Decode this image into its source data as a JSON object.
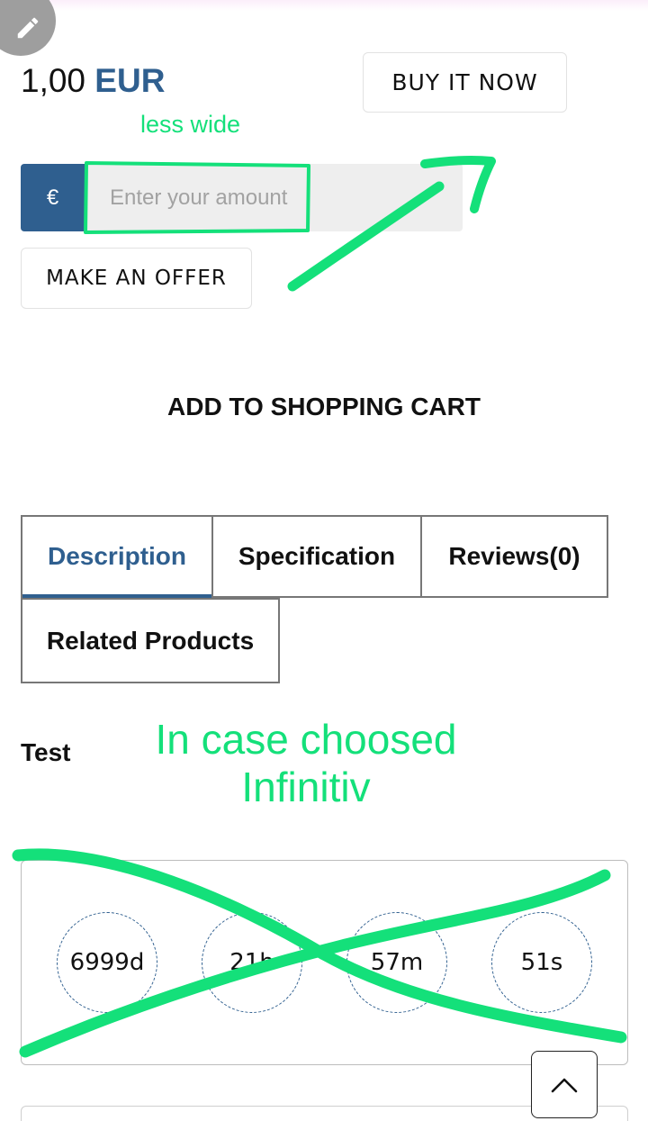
{
  "price": {
    "amount": "1,00",
    "currency": "EUR"
  },
  "buy_now": {
    "label": "BUY IT NOW"
  },
  "offer": {
    "currency_symbol": "€",
    "placeholder": "Enter your amount",
    "button_label": "MAKE AN OFFER"
  },
  "cart": {
    "label": "ADD TO SHOPPING CART"
  },
  "tabs": [
    {
      "label": "Description",
      "active": true
    },
    {
      "label": "Specification",
      "active": false
    },
    {
      "label": "Reviews(0)",
      "active": false
    },
    {
      "label": "Related Products",
      "active": false
    }
  ],
  "description_text": "Test",
  "countdown": {
    "days": "6999d",
    "hours": "21h",
    "minutes": "57m",
    "seconds": "51s"
  },
  "annotations": {
    "less_wide": "less wide",
    "case_line1": "In case choosed",
    "case_line2": "Infinitiv"
  },
  "colors": {
    "accent": "#2f5f8f",
    "annotation": "#14e07a",
    "input_bg": "#eeeeee"
  },
  "icons": {
    "edit": "pencil-icon",
    "scroll_top": "chevron-up-icon"
  }
}
